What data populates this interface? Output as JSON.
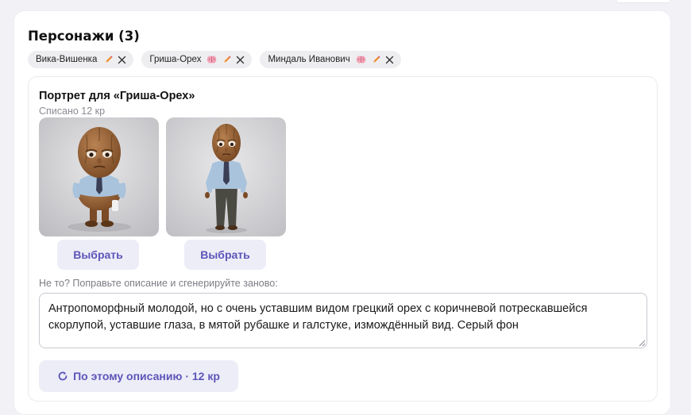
{
  "section": {
    "title": "Персонажи (3)"
  },
  "characters": [
    {
      "name": "Вика-Вишенка",
      "icons": [
        "pencil-icon",
        "close-icon"
      ]
    },
    {
      "name": "Гриша-Орех",
      "icons": [
        "brain-icon",
        "pencil-icon",
        "close-icon"
      ]
    },
    {
      "name": "Миндаль Иванович",
      "icons": [
        "brain-icon",
        "pencil-icon",
        "close-icon"
      ]
    }
  ],
  "portrait": {
    "title": "Портрет для «Гриша-Орех»",
    "charged": "Списано 12 кр",
    "options": [
      {
        "select_label": "Выбрать"
      },
      {
        "select_label": "Выбрать"
      }
    ],
    "hint": "Не то? Поправьте описание и сгенерируйте заново:",
    "description": "Антропоморфный молодой, но с очень уставшим видом грецкий орех с коричневой потрескавшейся скорлупой, уставшие глаза, в мятой рубашке и галстуке, измождённый вид. Серый фон",
    "regenerate_label": "По этому описанию · 12 кр",
    "regenerate_icon": "refresh-icon"
  },
  "colors": {
    "accent": "#5d55b8",
    "button_bg": "#ededf8",
    "chip_bg": "#eeeef1",
    "page_bg": "#f2f2f6"
  }
}
